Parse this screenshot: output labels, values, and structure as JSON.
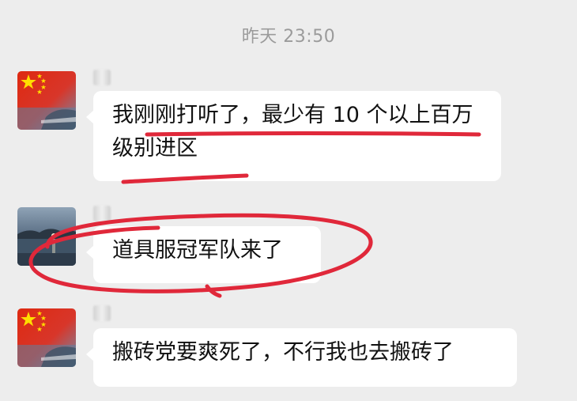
{
  "chat": {
    "timestamp": "昨天 23:50",
    "messages": [
      {
        "sender_avatar": "china-flag-avatar-icon",
        "text": "我刚刚打听了，最少有 10 个以上百万级别进区"
      },
      {
        "sender_avatar": "lake-scenery-avatar-icon",
        "text": "道具服冠军队来了"
      },
      {
        "sender_avatar": "china-flag-avatar-icon",
        "text": "搬砖党要爽死了，不行我也去搬砖了"
      }
    ]
  },
  "colors": {
    "background": "#ededed",
    "bubble": "#ffffff",
    "annotation": "#e0283a",
    "timestamp": "#9b9b9b"
  }
}
